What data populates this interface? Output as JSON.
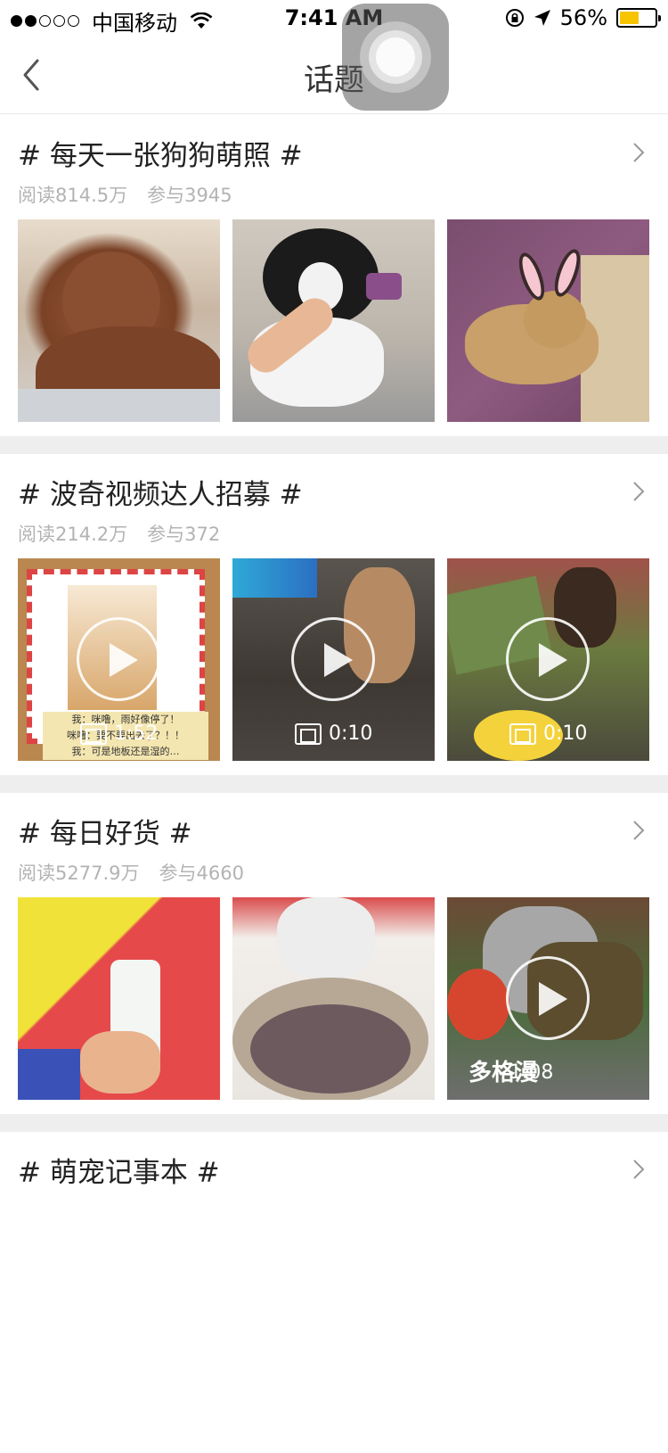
{
  "status": {
    "carrier": "中国移动",
    "time": "7:41 AM",
    "battery_percent": "56%",
    "battery_level": 0.56,
    "battery_color": "#f6c400"
  },
  "nav": {
    "title": "话题"
  },
  "topics": [
    {
      "title": "# 每天一张狗狗萌照 #",
      "reads": "阅读814.5万",
      "participants": "参与3945",
      "images": [
        {
          "icon": "photo-poodle-brown",
          "video": false
        },
        {
          "icon": "photo-poodle-black-white",
          "video": false
        },
        {
          "icon": "photo-dog-bunny-ears",
          "video": false
        }
      ]
    },
    {
      "title": "# 波奇视频达人招募 #",
      "reads": "阅读214.2万",
      "participants": "参与372",
      "images": [
        {
          "icon": "video-pomeranian-postcard",
          "video": true,
          "duration": "1:52"
        },
        {
          "icon": "video-poodle-sofa",
          "video": true,
          "duration": "0:10"
        },
        {
          "icon": "video-puppy-pikachu",
          "video": true,
          "duration": "0:10"
        }
      ],
      "captions": [
        "我：咪噜，雨好像停了！",
        "咪噜：要不要出去了？！！",
        "我：可是地板还是湿的…"
      ]
    },
    {
      "title": "# 每日好货 #",
      "reads": "阅读5277.9万",
      "participants": "参与4660",
      "images": [
        {
          "icon": "photo-foam-bottle",
          "video": false
        },
        {
          "icon": "photo-dog-food-bowl",
          "video": false
        },
        {
          "icon": "video-cat-harness",
          "video": true,
          "duration": "1:08",
          "overlay": "多格漫"
        }
      ]
    },
    {
      "title": "# 萌宠记事本 #",
      "reads": "",
      "participants": "",
      "images": []
    }
  ]
}
